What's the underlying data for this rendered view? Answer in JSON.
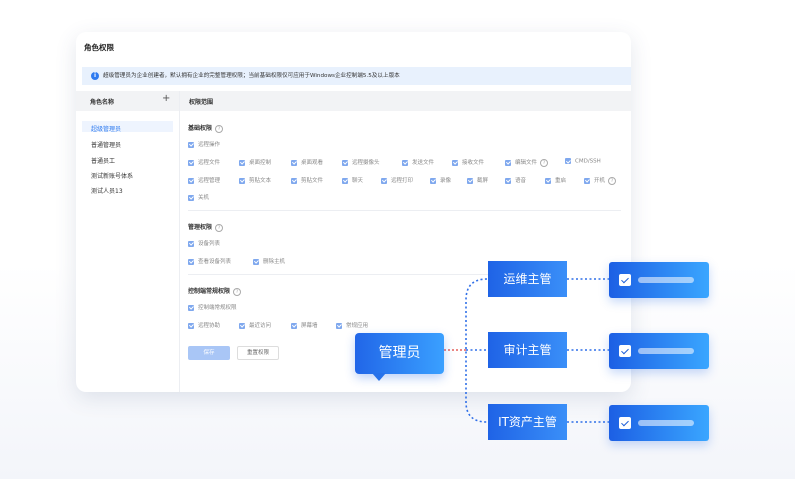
{
  "window": {
    "title": "角色权限",
    "notice": "超级管理员为企业创建者，默认拥有企业的完整管理权限；当前基础权限仅可应用于Windows企业控制端5.5及以上版本",
    "notice_icon": "info-icon"
  },
  "sidebar": {
    "header": "角色名称",
    "add_icon": "plus-icon",
    "items": [
      "超级管理员",
      "普通管理员",
      "普通员工",
      "测试新账号体系",
      "测试人员13"
    ],
    "active_index": 0
  },
  "content": {
    "header": "权限范围",
    "basic": {
      "title": "基础权限",
      "row1": [
        "远程操作"
      ],
      "row2": [
        "远程文件",
        "桌面控制",
        "桌面观看",
        "远程摄像头",
        "发送文件",
        "接收文件",
        "编辑文件",
        "CMD/SSH"
      ],
      "row3": [
        "远程管理",
        "剪贴文本",
        "剪贴文件",
        "聊天",
        "远程打印",
        "录像",
        "截屏",
        "语音",
        "重启",
        "开机"
      ],
      "row4": [
        "关机"
      ]
    },
    "manage": {
      "title": "管理权限",
      "row1": [
        "设备列表"
      ],
      "row2": [
        "查看设备列表",
        "删除主机"
      ]
    },
    "control": {
      "title": "控制端常规权限",
      "row1": [
        "控制端常规权限"
      ],
      "row2": [
        "远程协助",
        "最近访问",
        "屏幕墙",
        "常规应用"
      ]
    },
    "buttons": {
      "save": "保存",
      "reset": "重置权限"
    }
  },
  "overlay": {
    "admin_label": "管理员",
    "roles": [
      "运维主管",
      "审计主管",
      "IT资产主管"
    ],
    "colors": {
      "accent": "#2166e8",
      "connector_red": "#e0403a",
      "connector_blue": "#2f6fe8"
    }
  }
}
